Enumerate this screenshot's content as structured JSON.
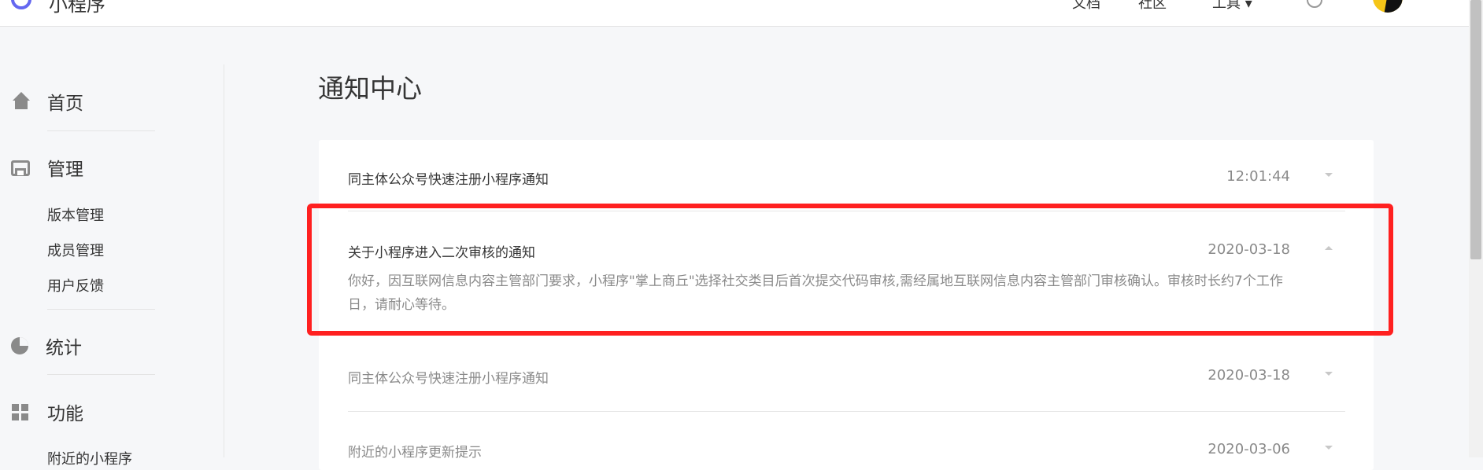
{
  "topbar": {
    "app_name": "小程序",
    "nav": [
      "文档",
      "社区",
      "工具 ▾"
    ]
  },
  "sidebar": {
    "home": "首页",
    "manage": "管理",
    "manage_items": [
      "版本管理",
      "成员管理",
      "用户反馈"
    ],
    "stats": "统计",
    "features": "功能",
    "feature_items": [
      "附近的小程序"
    ]
  },
  "main": {
    "title": "通知中心",
    "notices": [
      {
        "title": "同主体公众号快速注册小程序通知",
        "date": "12:01:44",
        "expanded": false
      },
      {
        "title": "关于小程序进入二次审核的通知",
        "date": "2020-03-18",
        "expanded": true,
        "body": "你好，因互联网信息内容主管部门要求，小程序\"掌上商丘\"选择社交类目后首次提交代码审核,需经属地互联网信息内容主管部门审核确认。审核时长约7个工作日，请耐心等待。"
      },
      {
        "title": "同主体公众号快速注册小程序通知",
        "date": "2020-03-18",
        "expanded": false
      },
      {
        "title": "附近的小程序更新提示",
        "date": "2020-03-06",
        "expanded": false
      }
    ]
  },
  "colors": {
    "highlight": "#ff2020",
    "accent": "#6467f0"
  }
}
